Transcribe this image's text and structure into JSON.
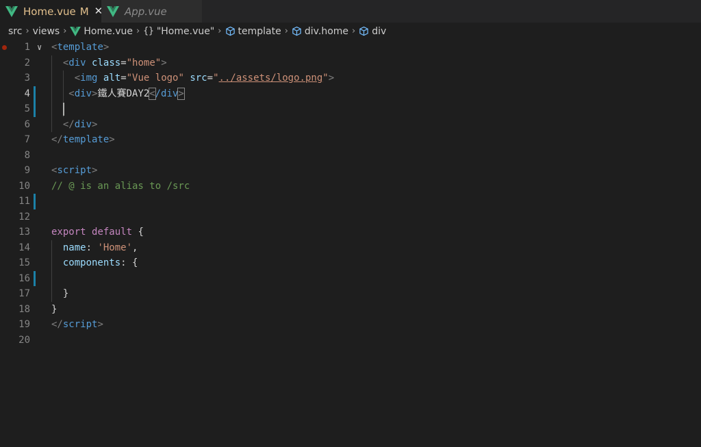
{
  "tabs": [
    {
      "label": "Home.vue",
      "modified": "M",
      "close": "✕",
      "active": true
    },
    {
      "label": "App.vue",
      "active": false
    }
  ],
  "breadcrumb": {
    "items": [
      "src",
      "views",
      "Home.vue",
      "\"Home.vue\"",
      "template",
      "div.home",
      "div"
    ],
    "separator": "›",
    "braces": "{}"
  },
  "editor": {
    "lines": [
      {
        "n": "1",
        "tokens": [
          [
            "tag-bracket",
            "<"
          ],
          [
            "tag",
            "template"
          ],
          [
            "tag-bracket",
            ">"
          ]
        ]
      },
      {
        "n": "2",
        "tokens": [
          [
            "text",
            "  "
          ],
          [
            "tag-bracket",
            "<"
          ],
          [
            "tag",
            "div"
          ],
          [
            "text",
            " "
          ],
          [
            "attr",
            "class"
          ],
          [
            "text",
            "="
          ],
          [
            "str",
            "\"home\""
          ],
          [
            "tag-bracket",
            ">"
          ]
        ]
      },
      {
        "n": "3",
        "tokens": [
          [
            "text",
            "    "
          ],
          [
            "tag-bracket",
            "<"
          ],
          [
            "tag",
            "img"
          ],
          [
            "text",
            " "
          ],
          [
            "attr",
            "alt"
          ],
          [
            "text",
            "="
          ],
          [
            "str",
            "\"Vue logo\""
          ],
          [
            "text",
            " "
          ],
          [
            "attr",
            "src"
          ],
          [
            "text",
            "="
          ],
          [
            "str",
            "\""
          ],
          [
            "str-u",
            "../assets/logo.png"
          ],
          [
            "str",
            "\""
          ],
          [
            "tag-bracket",
            ">"
          ]
        ]
      },
      {
        "n": "4",
        "tokens": [
          [
            "text",
            "   "
          ],
          [
            "tag-bracket",
            "<"
          ],
          [
            "tag",
            "div"
          ],
          [
            "tag-bracket",
            ">"
          ],
          [
            "text",
            "鐵人賽DAY2"
          ],
          [
            "tag-bracket-m",
            "<"
          ],
          [
            "tag",
            "/div"
          ],
          [
            "tag-bracket-m",
            ">"
          ]
        ]
      },
      {
        "n": "5",
        "tokens": []
      },
      {
        "n": "6",
        "tokens": [
          [
            "text",
            "  "
          ],
          [
            "tag-bracket",
            "</"
          ],
          [
            "tag",
            "div"
          ],
          [
            "tag-bracket",
            ">"
          ]
        ]
      },
      {
        "n": "7",
        "tokens": [
          [
            "tag-bracket",
            "</"
          ],
          [
            "tag",
            "template"
          ],
          [
            "tag-bracket",
            ">"
          ]
        ]
      },
      {
        "n": "8",
        "tokens": []
      },
      {
        "n": "9",
        "tokens": [
          [
            "tag-bracket",
            "<"
          ],
          [
            "tag",
            "script"
          ],
          [
            "tag-bracket",
            ">"
          ]
        ]
      },
      {
        "n": "10",
        "tokens": [
          [
            "comment",
            "// @ is an alias to /src"
          ]
        ]
      },
      {
        "n": "11",
        "tokens": []
      },
      {
        "n": "12",
        "tokens": []
      },
      {
        "n": "13",
        "tokens": [
          [
            "kw",
            "export"
          ],
          [
            "text",
            " "
          ],
          [
            "kw",
            "default"
          ],
          [
            "text",
            " {"
          ]
        ]
      },
      {
        "n": "14",
        "tokens": [
          [
            "text",
            "  "
          ],
          [
            "prop",
            "name"
          ],
          [
            "text",
            ": "
          ],
          [
            "str",
            "'Home'"
          ],
          [
            "text",
            ","
          ]
        ]
      },
      {
        "n": "15",
        "tokens": [
          [
            "text",
            "  "
          ],
          [
            "prop",
            "components"
          ],
          [
            "text",
            ": {"
          ]
        ]
      },
      {
        "n": "16",
        "tokens": []
      },
      {
        "n": "17",
        "tokens": [
          [
            "text",
            "  }"
          ]
        ]
      },
      {
        "n": "18",
        "tokens": [
          [
            "text",
            "}"
          ]
        ]
      },
      {
        "n": "19",
        "tokens": [
          [
            "tag-bracket",
            "</"
          ],
          [
            "tag",
            "script"
          ],
          [
            "tag-bracket",
            ">"
          ]
        ]
      },
      {
        "n": "20",
        "tokens": []
      }
    ]
  },
  "colors": {
    "vue_green": "#41b883",
    "vue_dark": "#2f7b5a",
    "modified": "#e2c08d",
    "breadcrumb_icon": "#75beff"
  }
}
